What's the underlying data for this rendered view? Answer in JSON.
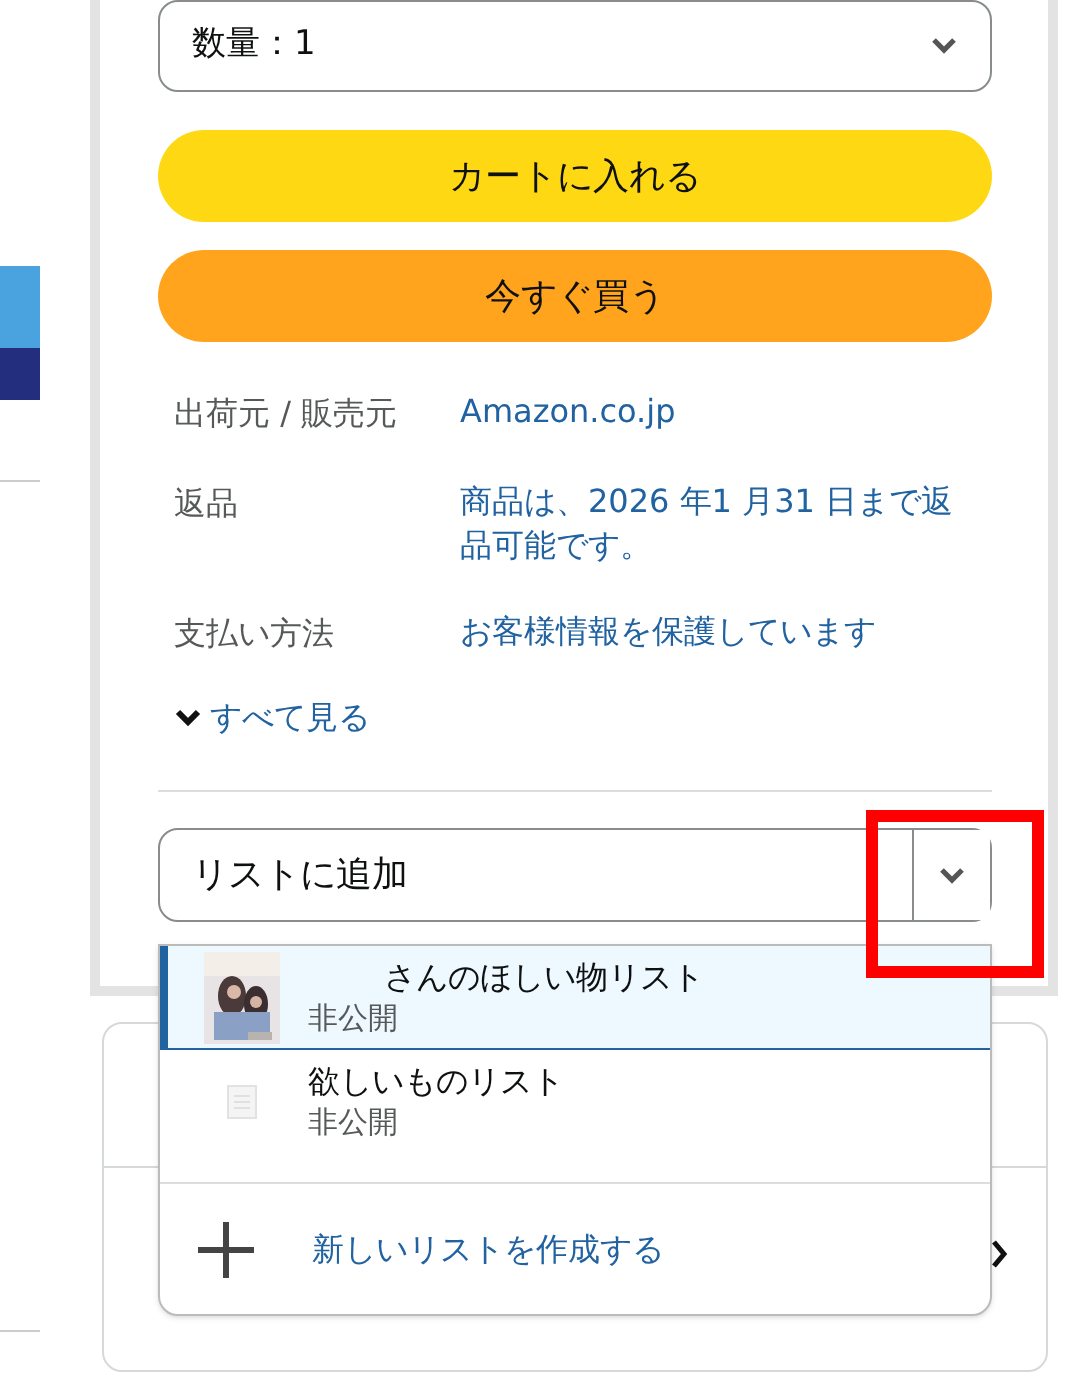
{
  "quantity_select": {
    "label": "数量：1"
  },
  "buttons": [
    {
      "label": "カートに入れる",
      "kind": "cart"
    },
    {
      "label": "今すぐ買う",
      "kind": "buy"
    }
  ],
  "details": [
    {
      "label": "出荷元 / 販売元",
      "value": "Amazon.co.jp"
    },
    {
      "label": "返品",
      "value": "商品は、2026 年1 月31 日まで返品可能です。"
    },
    {
      "label": "支払い方法",
      "value": "お客様情報を保護しています"
    }
  ],
  "see_all": "すべて見る",
  "add_to_list": {
    "label": "リストに追加",
    "expanded": true
  },
  "list_menu": [
    {
      "kind": "list",
      "name": "さんのほしい物リスト",
      "privacy": "非公開",
      "has_picture": true,
      "selected": true
    },
    {
      "kind": "list",
      "name": "欲しいものリスト",
      "privacy": "非公開",
      "has_picture": false,
      "selected": false
    },
    {
      "kind": "create",
      "name": "新しいリストを作成する"
    }
  ]
}
